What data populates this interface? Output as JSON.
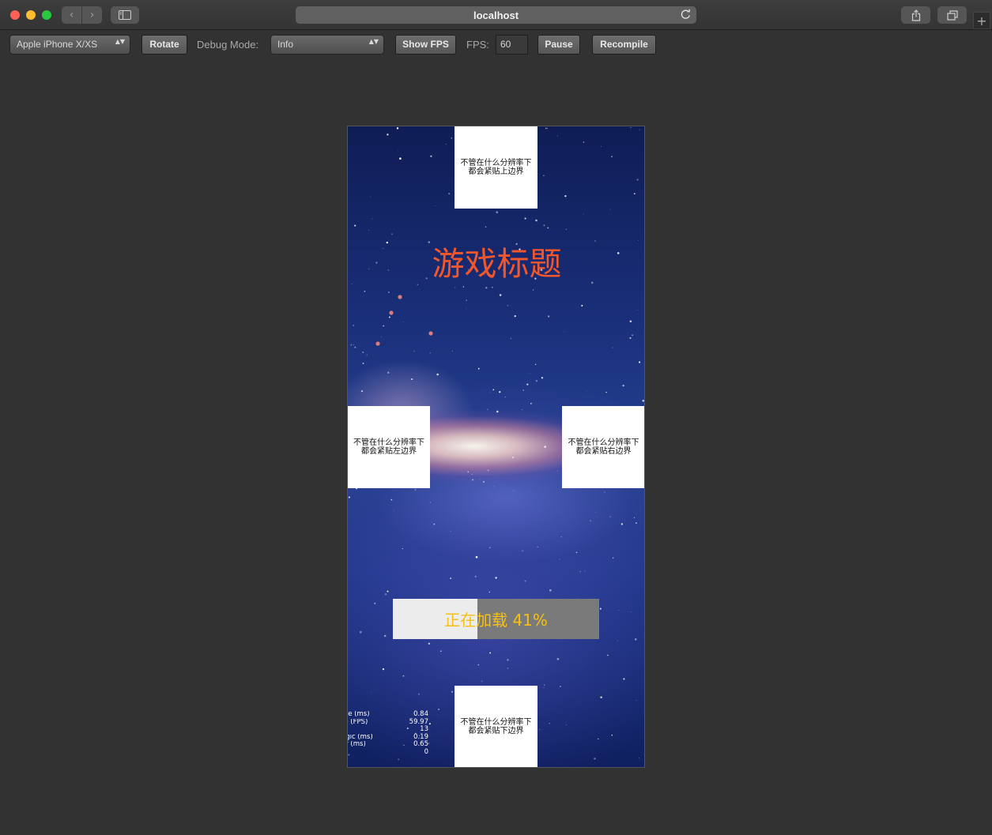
{
  "browser": {
    "url": "localhost",
    "back_glyph": "‹",
    "forward_glyph": "›",
    "new_tab_glyph": "+"
  },
  "toolbar": {
    "device": "Apple iPhone X/XS",
    "rotate_label": "Rotate",
    "debug_mode_label": "Debug Mode:",
    "debug_mode_value": "Info",
    "show_fps_label": "Show FPS",
    "fps_label": "FPS:",
    "fps_value": "60",
    "pause_label": "Pause",
    "recompile_label": "Recompile",
    "select_arrows": "▲▼"
  },
  "game": {
    "title": "游戏标题",
    "boxes": {
      "top": [
        "不管在什么分辨率下",
        "都会紧贴上边界"
      ],
      "left": [
        "不管在什么分辨率下",
        "都会紧贴左边界"
      ],
      "right": [
        "不管在什么分辨率下",
        "都会紧贴右边界"
      ],
      "bottom": [
        "不管在什么分辨率下",
        "都会紧贴下边界"
      ]
    },
    "loading": {
      "text": "正在加载 41%",
      "progress": 0.41
    },
    "stats": [
      {
        "label": "me (ms)",
        "value": "0.84"
      },
      {
        "label": "te (FPS)",
        "value": "59.97"
      },
      {
        "label": "ll",
        "value": "13"
      },
      {
        "label": "ogic (ms)",
        "value": "0.19"
      },
      {
        "label": "er (ms)",
        "value": "0.65"
      },
      {
        "label": "",
        "value": "0"
      }
    ]
  },
  "colors": {
    "title": "#f2562a",
    "loading_text": "#f5c016",
    "progress_track": "#7a7a7a",
    "progress_fill": "#ececec"
  }
}
